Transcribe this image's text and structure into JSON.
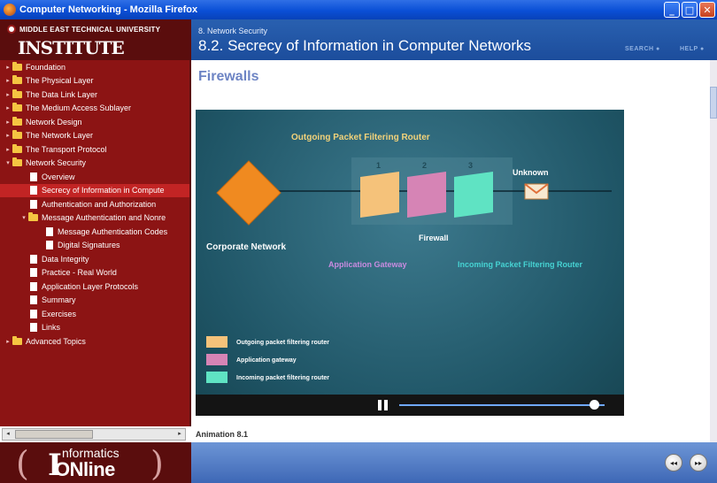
{
  "window": {
    "title": "Computer Networking - Mozilla Firefox",
    "buttons": {
      "minimize": "_",
      "maximize": "□",
      "close": "✕"
    }
  },
  "left": {
    "university": "MIDDLE EAST TECHNICAL UNIVERSITY",
    "institute": "INSTITUTE",
    "tree": [
      {
        "label": "Foundation",
        "indent": 0,
        "type": "folder",
        "arrow": "▸",
        "active": false
      },
      {
        "label": "The Physical Layer",
        "indent": 0,
        "type": "folder",
        "arrow": "▸",
        "active": false
      },
      {
        "label": "The Data Link Layer",
        "indent": 0,
        "type": "folder",
        "arrow": "▸",
        "active": false
      },
      {
        "label": "The Medium Access Sublayer",
        "indent": 0,
        "type": "folder",
        "arrow": "▸",
        "active": false
      },
      {
        "label": "Network Design",
        "indent": 0,
        "type": "folder",
        "arrow": "▸",
        "active": false
      },
      {
        "label": "The Network Layer",
        "indent": 0,
        "type": "folder",
        "arrow": "▸",
        "active": false
      },
      {
        "label": "The Transport Protocol",
        "indent": 0,
        "type": "folder",
        "arrow": "▸",
        "active": false
      },
      {
        "label": "Network Security",
        "indent": 0,
        "type": "folder",
        "arrow": "▾",
        "active": false
      },
      {
        "label": "Overview",
        "indent": 1,
        "type": "page",
        "arrow": "",
        "active": false
      },
      {
        "label": "Secrecy of Information in Compute",
        "indent": 1,
        "type": "page",
        "arrow": "",
        "active": true
      },
      {
        "label": "Authentication and Authorization",
        "indent": 1,
        "type": "page",
        "arrow": "",
        "active": false
      },
      {
        "label": "Message Authentication and Nonre",
        "indent": 1,
        "type": "folder",
        "arrow": "▾",
        "active": false
      },
      {
        "label": "Message Authentication Codes",
        "indent": 2,
        "type": "page",
        "arrow": "",
        "active": false
      },
      {
        "label": "Digital Signatures",
        "indent": 2,
        "type": "page",
        "arrow": "",
        "active": false
      },
      {
        "label": "Data Integrity",
        "indent": 1,
        "type": "page",
        "arrow": "",
        "active": false
      },
      {
        "label": "Practice - Real World",
        "indent": 1,
        "type": "page",
        "arrow": "",
        "active": false
      },
      {
        "label": "Application Layer Protocols",
        "indent": 1,
        "type": "page",
        "arrow": "",
        "active": false
      },
      {
        "label": "Summary",
        "indent": 1,
        "type": "page",
        "arrow": "",
        "active": false
      },
      {
        "label": "Exercises",
        "indent": 1,
        "type": "page",
        "arrow": "",
        "active": false
      },
      {
        "label": "Links",
        "indent": 1,
        "type": "page",
        "arrow": "",
        "active": false
      },
      {
        "label": "Advanced Topics",
        "indent": 0,
        "type": "folder",
        "arrow": "▸",
        "active": false
      }
    ],
    "logo": {
      "informatics": "nformatics",
      "online": "ONline",
      "big_i": "I"
    }
  },
  "header": {
    "section": "8. Network Security",
    "title": "8.2. Secrecy of Information in Computer Networks",
    "search": "SEARCH",
    "help": "HELP"
  },
  "content": {
    "heading": "Firewalls",
    "caption": "Animation 8.1",
    "animation": {
      "outgoing_title": "Outgoing Packet Filtering Router",
      "unknown": "Unknown",
      "corporate": "Corporate Network",
      "firewall": "Firewall",
      "app_gateway": "Application Gateway",
      "incoming": "Incoming Packet Filtering Router",
      "numbers": [
        "1",
        "2",
        "3"
      ],
      "legend": [
        {
          "label": "Outgoing packet filtering router",
          "color": "#f5c27a"
        },
        {
          "label": "Application gateway",
          "color": "#d684b5"
        },
        {
          "label": "Incoming packet filtering router",
          "color": "#5fe3c3"
        }
      ],
      "progress": 0.95
    }
  },
  "nav": {
    "prev": "◂◂",
    "next": "▸▸"
  },
  "colors": {
    "outgoing_text": "#f2d27a",
    "unknown_text": "#ffffff",
    "app_gateway_text": "#c98be0",
    "incoming_text": "#46d3d3",
    "diamond": "#f08a20"
  }
}
